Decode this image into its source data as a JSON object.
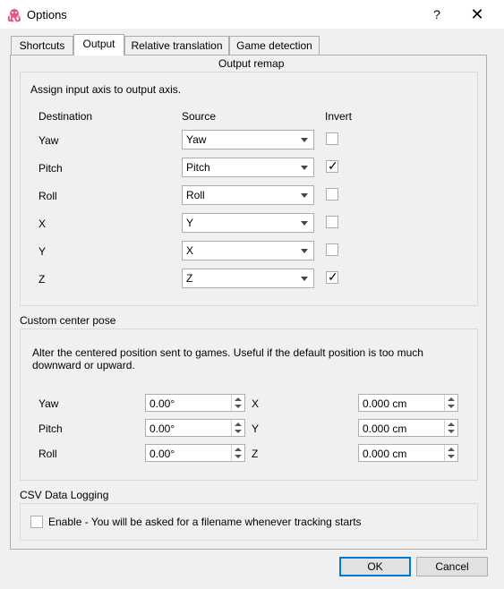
{
  "window": {
    "title": "Options",
    "help_glyph": "?",
    "close_glyph": "✕"
  },
  "tabs": [
    {
      "label": "Shortcuts"
    },
    {
      "label": "Output",
      "active": true
    },
    {
      "label": "Relative translation"
    },
    {
      "label": "Game detection"
    }
  ],
  "output_remap": {
    "title": "Output remap",
    "instruction": "Assign input axis to output axis.",
    "headers": {
      "destination": "Destination",
      "source": "Source",
      "invert": "Invert"
    },
    "rows": [
      {
        "destination": "Yaw",
        "source": "Yaw",
        "invert": false
      },
      {
        "destination": "Pitch",
        "source": "Pitch",
        "invert": true
      },
      {
        "destination": "Roll",
        "source": "Roll",
        "invert": false
      },
      {
        "destination": "X",
        "source": "Y",
        "invert": false
      },
      {
        "destination": "Y",
        "source": "X",
        "invert": false
      },
      {
        "destination": "Z",
        "source": "Z",
        "invert": true
      }
    ],
    "check_glyph": "✓"
  },
  "center_pose": {
    "title": "Custom center pose",
    "description": "Alter the centered position sent to games. Useful if the default position is too much downward or upward.",
    "rotation": [
      {
        "label": "Yaw",
        "value": "0.00°"
      },
      {
        "label": "Pitch",
        "value": "0.00°"
      },
      {
        "label": "Roll",
        "value": "0.00°"
      }
    ],
    "translation": [
      {
        "label": "X",
        "value": "0.000 cm"
      },
      {
        "label": "Y",
        "value": "0.000 cm"
      },
      {
        "label": "Z",
        "value": "0.000 cm"
      }
    ]
  },
  "csv_logging": {
    "title": "CSV Data Logging",
    "enable_label": "Enable - You will be asked for a filename whenever tracking starts",
    "enabled": false
  },
  "footer": {
    "ok_label": "OK",
    "cancel_label": "Cancel"
  },
  "colors": {
    "accent": "#0078d7",
    "icon": "#e0558f"
  }
}
